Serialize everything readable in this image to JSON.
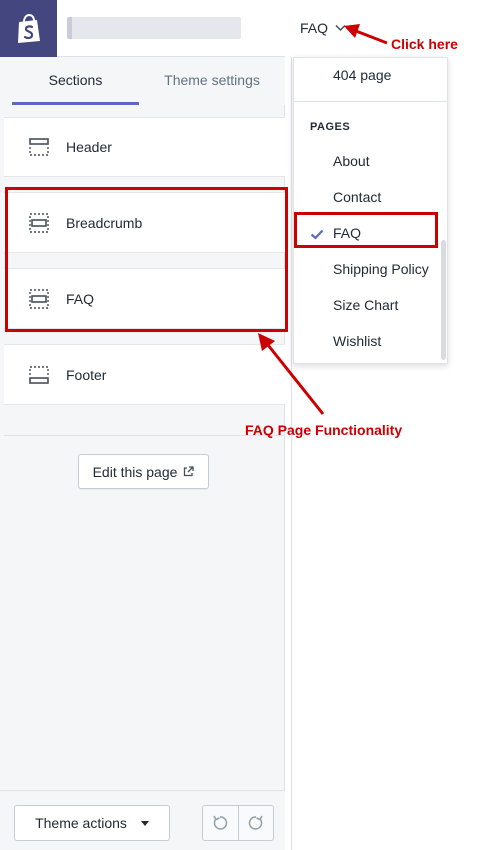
{
  "colors": {
    "logo_bg": "#43467f",
    "tab_accent": "#5c6ac4",
    "annotation_red": "#cc0000",
    "sidebar_bg": "#f4f6f8"
  },
  "logo": {
    "icon": "shopify-bag-icon"
  },
  "tabs": [
    {
      "label": "Sections",
      "active": true
    },
    {
      "label": "Theme settings",
      "active": false
    }
  ],
  "sections": [
    {
      "label": "Header",
      "icon": "header-section-icon"
    },
    {
      "label": "Breadcrumb",
      "icon": "section-icon"
    },
    {
      "label": "FAQ",
      "icon": "section-icon"
    },
    {
      "label": "Footer",
      "icon": "footer-section-icon"
    }
  ],
  "edit_page_label": "Edit this page",
  "bottom": {
    "theme_actions_label": "Theme actions",
    "undo_icon": "undo-icon",
    "redo_icon": "redo-icon"
  },
  "page_selector": {
    "current": "FAQ",
    "icon": "chevron-down-icon"
  },
  "dropdown": {
    "top_item": "404 page",
    "heading": "PAGES",
    "options": [
      {
        "label": "About",
        "selected": false
      },
      {
        "label": "Contact",
        "selected": false
      },
      {
        "label": "FAQ",
        "selected": true
      },
      {
        "label": "Shipping Policy",
        "selected": false
      },
      {
        "label": "Size Chart",
        "selected": false
      },
      {
        "label": "Wishlist",
        "selected": false
      }
    ]
  },
  "annotations": {
    "click_here": "Click here",
    "faq_functionality": "FAQ Page Functionality"
  }
}
